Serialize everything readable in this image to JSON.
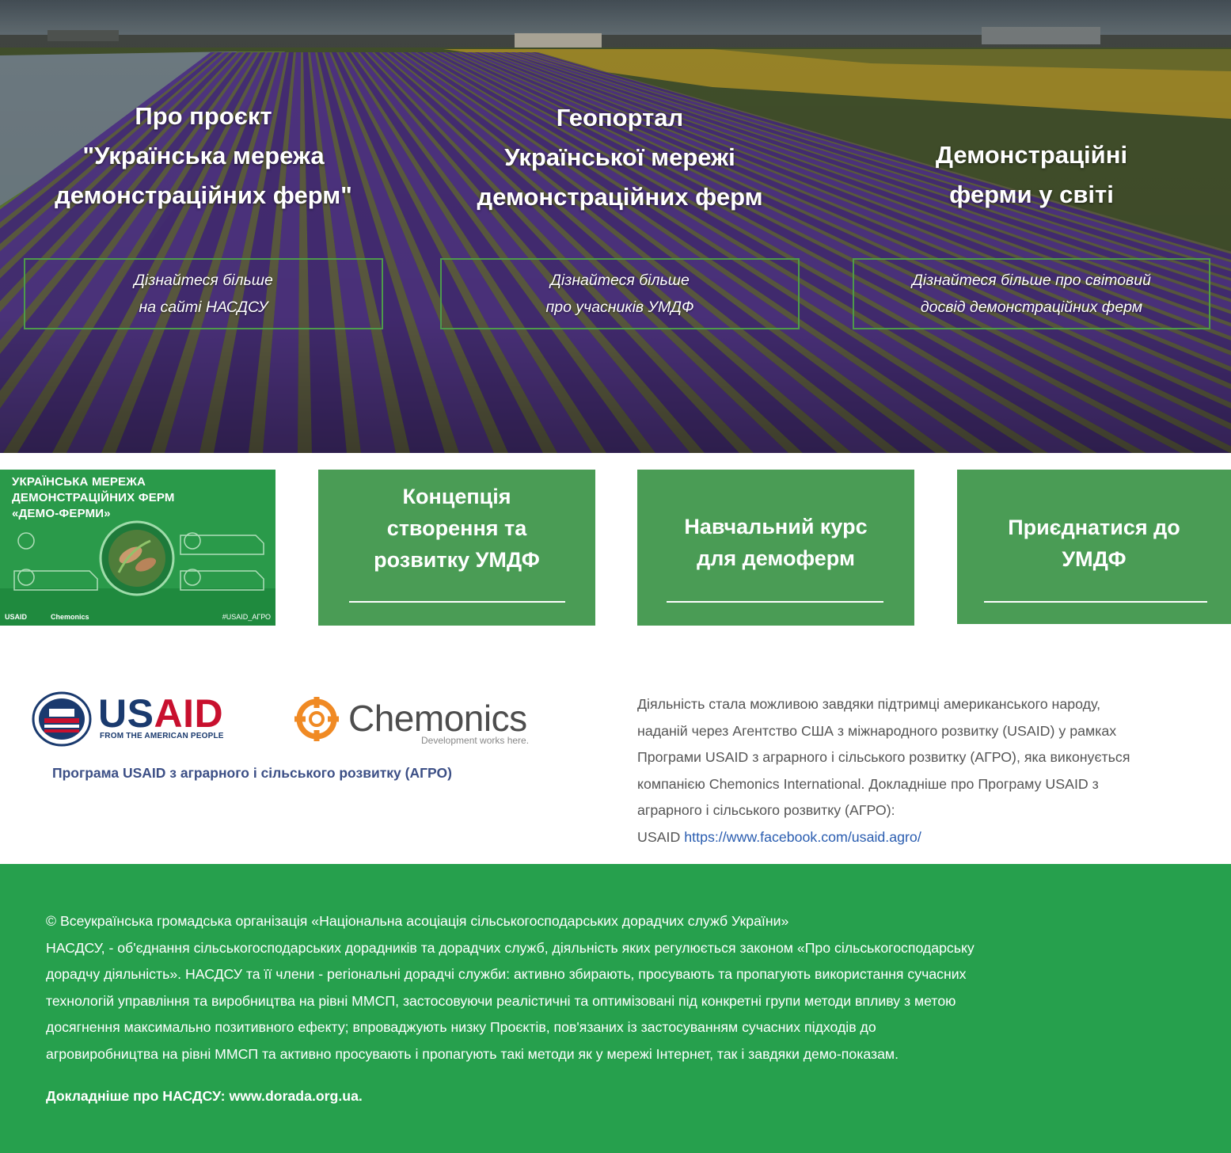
{
  "hero": {
    "columns": [
      {
        "title_lines": [
          "Про проєкт",
          "\"Українська мережа",
          "демонстраційних ферм\""
        ],
        "link_lines": [
          "Дізнайтеся більше",
          "на сайті НАСДСУ"
        ]
      },
      {
        "title_lines": [
          "Геопортал",
          "Української мережі",
          "демонстраційних ферм"
        ],
        "link_lines": [
          "Дізнайтеся більше",
          "про учасників УМДФ"
        ]
      },
      {
        "title_lines": [
          "Демонстраційні",
          "ферми у світі"
        ],
        "link_lines": [
          "Дізнайтеся більше про світовий",
          "досвід демонстраційних ферм"
        ]
      }
    ]
  },
  "banner": {
    "title_lines": [
      "УКРАЇНСЬКА МЕРЕЖА",
      "ДЕМОНСТРАЦІЙНИХ ФЕРМ",
      "«ДЕМО-ФЕРМИ»"
    ],
    "footer_items": [
      "USAID",
      "Chemonics",
      "#USAID_AГРО"
    ]
  },
  "tiles": [
    {
      "lines": [
        "Концепція",
        "створення та",
        "розвитку УМДФ"
      ]
    },
    {
      "lines": [
        "Навчальний курс",
        "для демоферм"
      ]
    },
    {
      "lines": [
        "Приєднатися до",
        "УМДФ"
      ]
    }
  ],
  "sponsors": {
    "usaid_word_a": "US",
    "usaid_word_b": "AID",
    "usaid_tagline": "FROM THE AMERICAN PEOPLE",
    "chemonics_word": "Chemonics",
    "chemonics_tagline": "Development works here.",
    "program": "Програма USAID з аграрного і сільського розвитку (АГРО)"
  },
  "about": {
    "lines": [
      "Діяльність стала можливою завдяки підтримці американського народу,",
      "наданій через Агентство США з міжнародного розвитку (USAID) у рамках",
      "Програми USAID з аграрного і сільського розвитку (АГРО), яка виконується",
      "компанією Chemonics International. Докладніше про Програму USAID з",
      "аграрного і сільського розвитку (АГРО):"
    ],
    "link_prefix": "USAID",
    "link_text": "https://www.facebook.com/usaid.agro/"
  },
  "footer": {
    "lines": [
      "© Всеукраїнська громадська організація «Національна асоціація сільськогосподарських дорадчих служб України»",
      "НАСДСУ, - об'єднання сільськогосподарських дорадників та дорадчих служб, діяльність яких регулюється законом «Про сільськогосподарську",
      "дорадчу діяльність». НАСДСУ та її члени - регіональні дорадчі служби: активно збирають, просувають та пропагують використання сучасних",
      "технологій управління та виробництва на рівні ММСП, застосовуючи реалістичні та оптимізовані під конкретні групи методи впливу з метою",
      "досягнення максимально позитивного ефекту; впроваджують низку Проєктів, пов'язаних із застосуванням сучасних підходів до",
      "агровиробництва на рівні ММСП та активно просувають і пропагують такі методи як у мережі Інтернет, так і завдяки демо-показам."
    ],
    "more": "Докладніше про НАСДСУ: www.dorada.org.ua."
  },
  "colors": {
    "green_tile": "#4a9c55",
    "footer_green": "#26a04d",
    "banner_green": "#2b9a4b",
    "box_border": "#4e9a4a"
  }
}
